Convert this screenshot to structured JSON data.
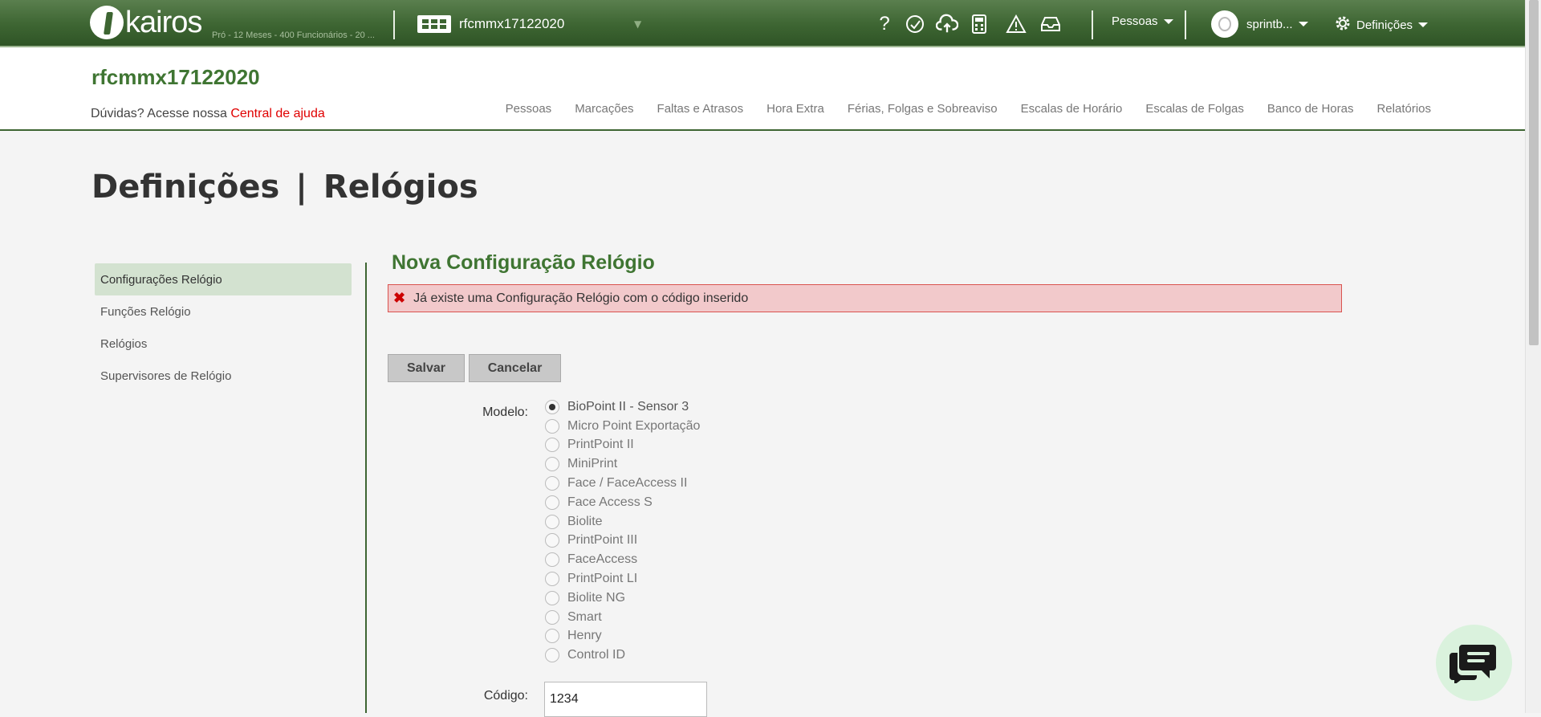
{
  "topbar": {
    "logo_text": "kairos",
    "logo_subtitle": "Pró - 12 Meses - 400 Funcionários - 20 ...",
    "company": "rfcmmx17122020",
    "icons": [
      "question-icon",
      "headset-icon",
      "cloud-upload-icon",
      "calculator-icon",
      "warning-icon",
      "inbox-icon"
    ],
    "people_menu": "Pessoas",
    "user_menu": "sprintb...",
    "settings_menu": "Definições"
  },
  "header": {
    "company_title": "rfcmmx17122020",
    "help_text": "Dúvidas? Acesse nossa",
    "help_link": "Central de ajuda",
    "nav": [
      "Pessoas",
      "Marcações",
      "Faltas e Atrasos",
      "Hora Extra",
      "Férias, Folgas e Sobreaviso",
      "Escalas de Horário",
      "Escalas de Folgas",
      "Banco de Horas",
      "Relatórios"
    ]
  },
  "page": {
    "title_section": "Definições",
    "title_separator": "|",
    "title_page": "Relógios"
  },
  "sidebar": {
    "items": [
      {
        "label": "Configurações Relógio",
        "active": true
      },
      {
        "label": "Funções Relógio",
        "active": false
      },
      {
        "label": "Relógios",
        "active": false
      },
      {
        "label": "Supervisores de Relógio",
        "active": false
      }
    ]
  },
  "form": {
    "title": "Nova Configuração Relógio",
    "error_message": "Já existe uma Configuração Relógio com o código inserido",
    "save_label": "Salvar",
    "cancel_label": "Cancelar",
    "model_label": "Modelo:",
    "models": [
      "BioPoint II - Sensor 3",
      "Micro Point Exportação",
      "PrintPoint II",
      "MiniPrint",
      "Face / FaceAccess II",
      "Face Access S",
      "Biolite",
      "PrintPoint III",
      "FaceAccess",
      "PrintPoint LI",
      "Biolite NG",
      "Smart",
      "Henry",
      "Control ID"
    ],
    "selected_model": "BioPoint II - Sensor 3",
    "code_label": "Código:",
    "code_value": "1234"
  },
  "chat": {
    "icon": "chat-icon"
  },
  "colors": {
    "brand_green": "#3d6532",
    "title_green": "#3f7532",
    "error_bg": "#f2c9cb",
    "error_border": "#d9534f",
    "link_red": "#e00000"
  }
}
